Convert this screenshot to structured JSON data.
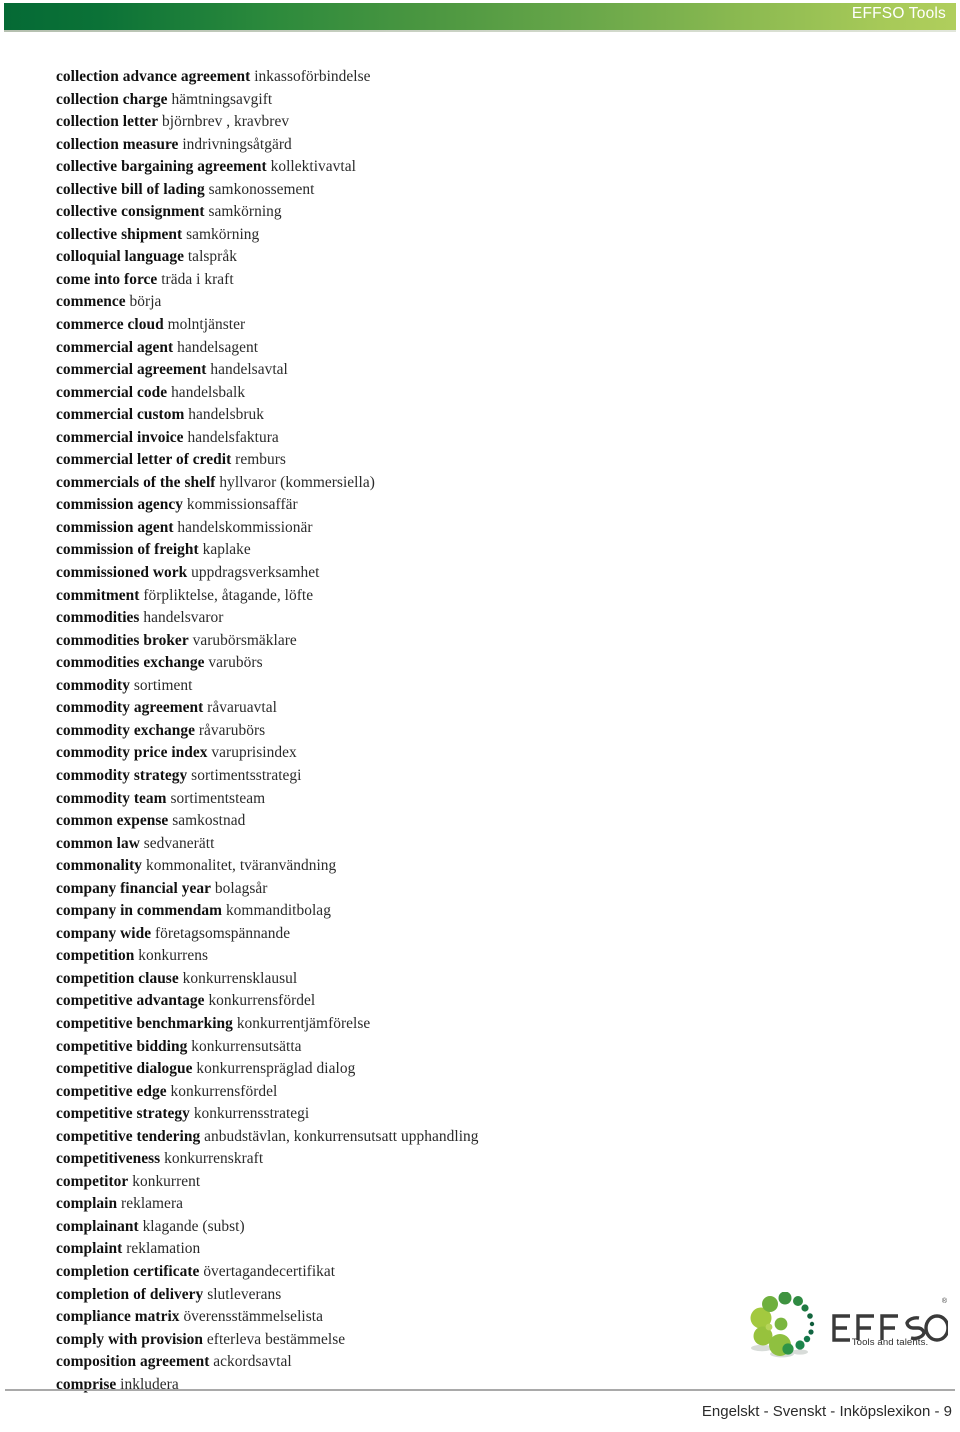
{
  "header": {
    "title": "EFFSO Tools",
    "gradient_start": "#056a35",
    "gradient_end": "#b0ce5c"
  },
  "entries": [
    {
      "term": "collection advance agreement",
      "definition": "inkassoförbindelse"
    },
    {
      "term": "collection charge",
      "definition": "hämtningsavgift"
    },
    {
      "term": "collection letter",
      "definition": "björnbrev , kravbrev"
    },
    {
      "term": "collection measure",
      "definition": "indrivningsåtgärd"
    },
    {
      "term": "collective bargaining agreement",
      "definition": "kollektivavtal"
    },
    {
      "term": "collective bill of lading",
      "definition": "samkonossement"
    },
    {
      "term": "collective consignment",
      "definition": "samkörning"
    },
    {
      "term": "collective shipment",
      "definition": "samkörning"
    },
    {
      "term": "colloquial language",
      "definition": "talspråk"
    },
    {
      "term": "come into force",
      "definition": "träda i kraft"
    },
    {
      "term": "commence",
      "definition": "börja"
    },
    {
      "term": "commerce cloud",
      "definition": "molntjänster"
    },
    {
      "term": "commercial agent",
      "definition": "handelsagent"
    },
    {
      "term": "commercial agreement",
      "definition": "handelsavtal"
    },
    {
      "term": "commercial code",
      "definition": "handelsbalk"
    },
    {
      "term": "commercial custom",
      "definition": "handelsbruk"
    },
    {
      "term": "commercial invoice",
      "definition": "handelsfaktura"
    },
    {
      "term": "commercial letter of credit",
      "definition": "remburs"
    },
    {
      "term": "commercials of the shelf",
      "definition": "hyllvaror (kommersiella)"
    },
    {
      "term": "commission agency",
      "definition": "kommissionsaffär"
    },
    {
      "term": "commission agent",
      "definition": "handelskommissionär"
    },
    {
      "term": "commission of freight",
      "definition": "kaplake"
    },
    {
      "term": "commissioned work",
      "definition": "uppdragsverksamhet"
    },
    {
      "term": "commitment",
      "definition": "förpliktelse, åtagande, löfte"
    },
    {
      "term": "commodities",
      "definition": "handelsvaror"
    },
    {
      "term": "commodities broker",
      "definition": "varubörsmäklare"
    },
    {
      "term": "commodities exchange",
      "definition": "varubörs"
    },
    {
      "term": "commodity",
      "definition": "sortiment"
    },
    {
      "term": "commodity agreement",
      "definition": "råvaruavtal"
    },
    {
      "term": "commodity exchange",
      "definition": "råvarubörs"
    },
    {
      "term": "commodity price index",
      "definition": "varuprisindex"
    },
    {
      "term": "commodity strategy",
      "definition": "sortimentsstrategi"
    },
    {
      "term": "commodity team",
      "definition": "sortimentsteam"
    },
    {
      "term": "common expense",
      "definition": "samkostnad"
    },
    {
      "term": "common law",
      "definition": "sedvanerätt"
    },
    {
      "term": "commonality",
      "definition": "kommonalitet, tväranvändning"
    },
    {
      "term": "company financial year",
      "definition": "bolagsår"
    },
    {
      "term": "company in commendam",
      "definition": "kommanditbolag"
    },
    {
      "term": "company wide",
      "definition": "företagsomspännande"
    },
    {
      "term": "competition",
      "definition": "konkurrens"
    },
    {
      "term": "competition clause",
      "definition": "konkurrensklausul"
    },
    {
      "term": "competitive advantage",
      "definition": "konkurrensfördel"
    },
    {
      "term": "competitive benchmarking",
      "definition": "konkurrentjämförelse"
    },
    {
      "term": "competitive bidding",
      "definition": "konkurrensutsätta"
    },
    {
      "term": "competitive dialogue",
      "definition": "konkurrenspräglad dialog"
    },
    {
      "term": "competitive edge",
      "definition": "konkurrensfördel"
    },
    {
      "term": "competitive strategy",
      "definition": "konkurrensstrategi"
    },
    {
      "term": "competitive tendering",
      "definition": "anbudstävlan, konkurrensutsatt upphandling"
    },
    {
      "term": "competitiveness",
      "definition": "konkurrenskraft"
    },
    {
      "term": "competitor",
      "definition": "konkurrent"
    },
    {
      "term": "complain",
      "definition": "reklamera"
    },
    {
      "term": "complainant",
      "definition": "klagande (subst)"
    },
    {
      "term": "complaint",
      "definition": "reklamation"
    },
    {
      "term": "completion certificate",
      "definition": "övertagandecertifikat"
    },
    {
      "term": "completion of delivery",
      "definition": "slutleverans"
    },
    {
      "term": "compliance matrix",
      "definition": "överensstämmelselista"
    },
    {
      "term": "comply with provision",
      "definition": "efterleva bestämmelse"
    },
    {
      "term": "composition agreement",
      "definition": "ackordsavtal"
    },
    {
      "term": "comprise",
      "definition": "inkludera"
    }
  ],
  "logo": {
    "wordmark": "EFFSO",
    "tagline": "Tools and talents.",
    "registered_mark": "®"
  },
  "footer": {
    "text": "Engelskt - Svenskt - Inköpslexikon - 9",
    "page_number": "9"
  }
}
